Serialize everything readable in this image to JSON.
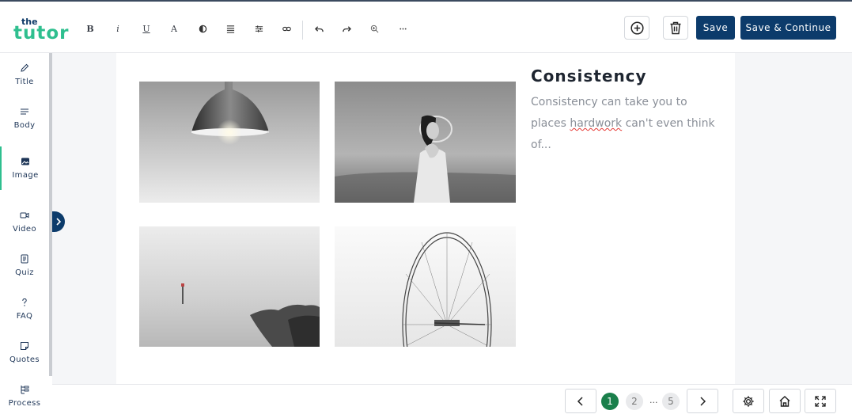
{
  "app": {
    "logo_top": "the",
    "logo_main": "tutor"
  },
  "toolbar": {
    "bold": "B",
    "italic": "i",
    "underline": "U",
    "font_color": "A",
    "save_label": "Save",
    "save_continue_label": "Save & Continue"
  },
  "sidebar": {
    "items": [
      {
        "label": "Title",
        "icon": "pencil-icon"
      },
      {
        "label": "Body",
        "icon": "lines-icon"
      },
      {
        "label": "Image",
        "icon": "image-icon"
      },
      {
        "label": "Video",
        "icon": "video-icon"
      },
      {
        "label": "Quiz",
        "icon": "quiz-icon"
      },
      {
        "label": "FAQ",
        "icon": "question-icon"
      },
      {
        "label": "Quotes",
        "icon": "note-icon"
      },
      {
        "label": "Process",
        "icon": "process-icon"
      }
    ],
    "active": "Image"
  },
  "content": {
    "heading": "Consistency",
    "body_pre": "Consistency can take you to places ",
    "body_flagged": "hardwork",
    "body_post": " can't even think of...",
    "images": [
      {
        "subject": "pendant lamp"
      },
      {
        "subject": "woman with hat"
      },
      {
        "subject": "misty sea rocks"
      },
      {
        "subject": "ferris wheel"
      }
    ]
  },
  "pagination": {
    "pages": [
      "1",
      "2",
      "5"
    ],
    "current": "1",
    "ellipsis": "..."
  },
  "colors": {
    "brand_navy": "#0c3b6b",
    "brand_green": "#2fbf8f",
    "page_active": "#1a7f4b"
  }
}
